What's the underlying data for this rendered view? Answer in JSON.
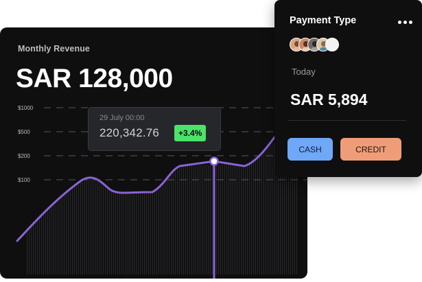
{
  "revenue": {
    "title": "Monthly Revenue",
    "amount": "SAR 128,000"
  },
  "colors": {
    "line": "#8b63d6",
    "grid": "#5a5a5d",
    "badge": "#4ce36a",
    "cash_button": "#6ea8f7",
    "credit_button": "#ef9d79"
  },
  "chart_data": {
    "type": "line",
    "y_tick_labels": [
      "$1000",
      "$500",
      "$200",
      "$100"
    ],
    "series": [
      {
        "values": [
          95,
          102,
          100,
          106,
          108
        ]
      }
    ],
    "grid": true
  },
  "tooltip": {
    "date": "29 July 00:00",
    "value": "220,342.76",
    "change": "+3.4%"
  },
  "payment": {
    "title": "Payment Type",
    "more_icon": "more-horizontal-icon",
    "avatar_count": 5,
    "today_label": "Today",
    "amount": "SAR 5,894",
    "cash_label": "CASH",
    "credit_label": "CREDIT"
  }
}
